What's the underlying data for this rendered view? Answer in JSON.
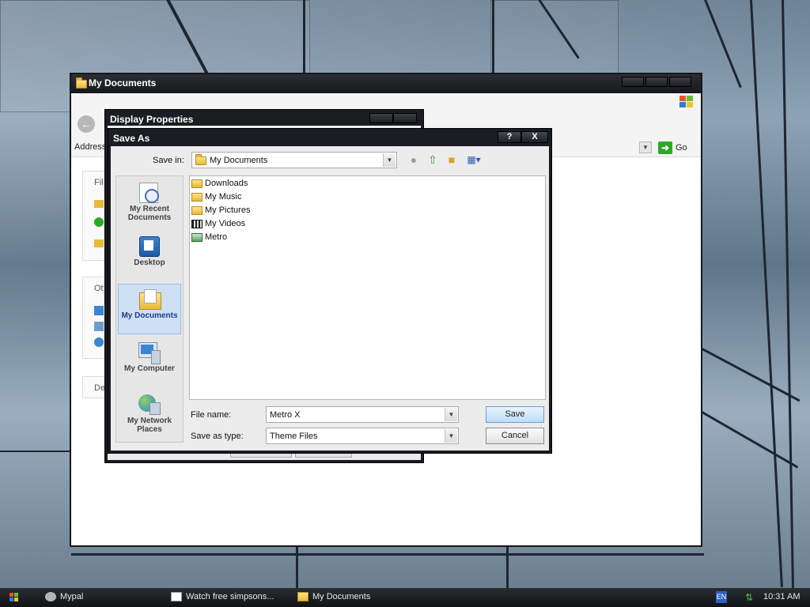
{
  "colors": {
    "titlebar": "#15181c",
    "selection": "#cde0f3",
    "save_button": "#bfdcf5",
    "taskbar": "#101214"
  },
  "my_documents_window": {
    "title": "My Documents",
    "address_label": "Address",
    "go_label": "Go",
    "side_labels": [
      "Fil",
      "Ot",
      "De"
    ]
  },
  "display_properties": {
    "title": "Display Properties"
  },
  "save_as": {
    "title": "Save As",
    "help_button": "?",
    "close_button": "X",
    "save_in_label": "Save in:",
    "save_in_value": "My Documents",
    "toolbar_icons": [
      "back-icon",
      "up-folder-icon",
      "new-folder-icon",
      "view-menu-icon"
    ],
    "places": [
      {
        "label": "My Recent Documents",
        "icon": "recent-documents-icon"
      },
      {
        "label": "Desktop",
        "icon": "desktop-icon"
      },
      {
        "label": "My Documents",
        "icon": "my-documents-icon",
        "selected": true
      },
      {
        "label": "My Computer",
        "icon": "my-computer-icon"
      },
      {
        "label": "My Network Places",
        "icon": "network-places-icon"
      }
    ],
    "files": [
      {
        "name": "Downloads",
        "icon": "folder-icon"
      },
      {
        "name": "My Music",
        "icon": "music-folder-icon"
      },
      {
        "name": "My Pictures",
        "icon": "pictures-folder-icon"
      },
      {
        "name": "My Videos",
        "icon": "videos-folder-icon"
      },
      {
        "name": "Metro",
        "icon": "theme-file-icon"
      }
    ],
    "file_name_label": "File name:",
    "file_name_value": "Metro X",
    "save_as_type_label": "Save as type:",
    "save_as_type_value": "Theme Files",
    "save_button": "Save",
    "cancel_button": "Cancel"
  },
  "taskbar": {
    "start_icon": "windows-flag-icon",
    "tasks": [
      {
        "label": "Mypal",
        "icon": "mypal-icon"
      },
      {
        "label": "Watch free simpsons...",
        "icon": "document-icon"
      },
      {
        "label": "My Documents",
        "icon": "folder-icon"
      }
    ],
    "language": "EN",
    "clock": "10:31 AM"
  }
}
